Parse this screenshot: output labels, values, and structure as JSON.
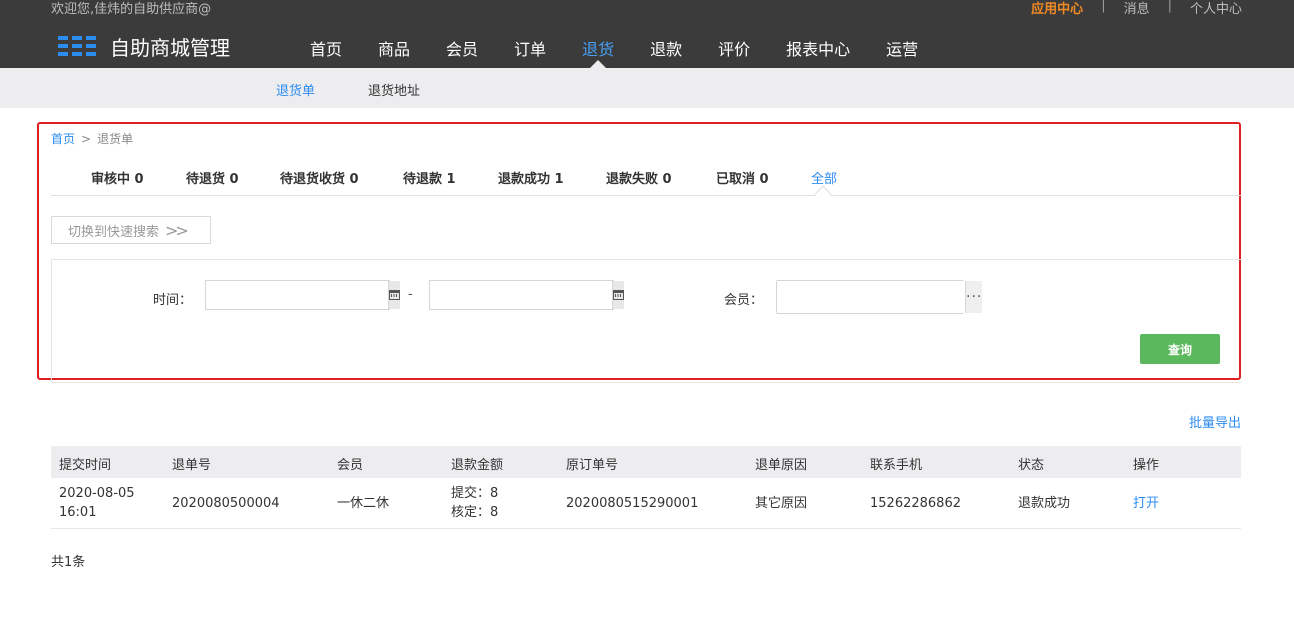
{
  "header": {
    "welcome": "欢迎您,佳炜的自助供应商@",
    "links": [
      "应用中心",
      "消息",
      "个人中心"
    ],
    "logo_text": "自助商城管理",
    "nav": [
      "首页",
      "商品",
      "会员",
      "订单",
      "退货",
      "退款",
      "评价",
      "报表中心",
      "运营"
    ],
    "active_nav": "退货"
  },
  "subnav": {
    "items": [
      "退货单",
      "退货地址"
    ],
    "active": "退货单"
  },
  "breadcrumb": {
    "home": "首页",
    "sep": ">",
    "current": "退货单"
  },
  "status_tabs": [
    "审核中 0",
    "待退货 0",
    "待退货收货 0",
    "待退款 1",
    "退款成功 1",
    "退款失败 0",
    "已取消 0",
    "全部"
  ],
  "active_tab": "全部",
  "search": {
    "switch_label": "切换到快速搜索",
    "time_label": "时间：",
    "range_sep": "-",
    "member_label": "会员：",
    "more": "···",
    "query_label": "查询"
  },
  "export_label": "批量导出",
  "table": {
    "columns": [
      "提交时间",
      "退单号",
      "会员",
      "退款金额",
      "原订单号",
      "退单原因",
      "联系手机",
      "状态",
      "操作"
    ],
    "rows": [
      {
        "submit_date": "2020-08-05",
        "submit_time": "16:01",
        "return_no": "2020080500004",
        "member": "一休二休",
        "amount_submit": "提交：8",
        "amount_approved": "核定：8",
        "order_no": "2020080515290001",
        "reason": "其它原因",
        "phone": "15262286862",
        "status": "退款成功",
        "action": "打开"
      }
    ]
  },
  "total": "共1条",
  "colors": {
    "accent": "#2d8cf0",
    "orange": "#f08a24",
    "green": "#5cb85c",
    "highlight": "#e02020"
  }
}
